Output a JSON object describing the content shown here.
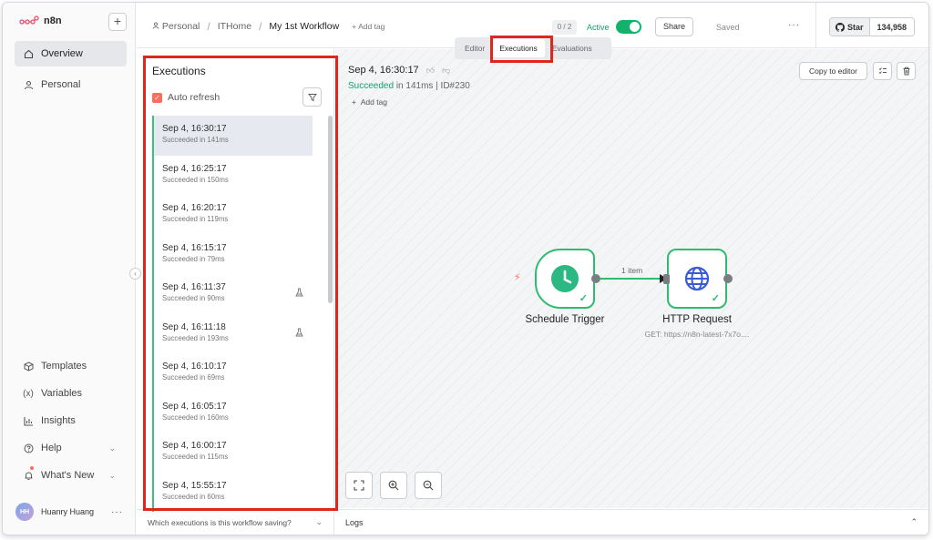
{
  "app": {
    "logo_text": "n8n"
  },
  "sidebar": {
    "plus": "+",
    "top_items": [
      {
        "label": "Overview",
        "icon": "home-icon"
      },
      {
        "label": "Personal",
        "icon": "user-icon"
      }
    ],
    "bottom_items": [
      {
        "label": "Templates",
        "icon": "box-icon"
      },
      {
        "label": "Variables",
        "icon": "variables-icon"
      },
      {
        "label": "Insights",
        "icon": "chart-icon"
      },
      {
        "label": "Help",
        "icon": "help-icon"
      },
      {
        "label": "What's New",
        "icon": "bell-icon"
      }
    ],
    "user": {
      "initials": "HH",
      "name": "Huanry Huang",
      "more": "···"
    }
  },
  "header": {
    "breadcrumb": {
      "project": "Personal",
      "folder": "ITHome",
      "workflow": "My 1st Workflow",
      "add_tag": "+ Add tag"
    },
    "counter": "0 / 2",
    "active_label": "Active",
    "share_label": "Share",
    "saved_label": "Saved",
    "more": "···",
    "github": {
      "star_label": "Star",
      "count": "134,958"
    }
  },
  "tabs": [
    {
      "label": "Editor"
    },
    {
      "label": "Executions"
    },
    {
      "label": "Evaluations"
    }
  ],
  "executions": {
    "title": "Executions",
    "auto_refresh_label": "Auto refresh",
    "items": [
      {
        "time": "Sep 4, 16:30:17",
        "status": "Succeeded in 141ms",
        "selected": true,
        "flask": false
      },
      {
        "time": "Sep 4, 16:25:17",
        "status": "Succeeded in 150ms",
        "selected": false,
        "flask": false
      },
      {
        "time": "Sep 4, 16:20:17",
        "status": "Succeeded in 119ms",
        "selected": false,
        "flask": false
      },
      {
        "time": "Sep 4, 16:15:17",
        "status": "Succeeded in 79ms",
        "selected": false,
        "flask": false
      },
      {
        "time": "Sep 4, 16:11:37",
        "status": "Succeeded in 90ms",
        "selected": false,
        "flask": true
      },
      {
        "time": "Sep 4, 16:11:18",
        "status": "Succeeded in 193ms",
        "selected": false,
        "flask": true
      },
      {
        "time": "Sep 4, 16:10:17",
        "status": "Succeeded in 69ms",
        "selected": false,
        "flask": false
      },
      {
        "time": "Sep 4, 16:05:17",
        "status": "Succeeded in 160ms",
        "selected": false,
        "flask": false
      },
      {
        "time": "Sep 4, 16:00:17",
        "status": "Succeeded in 115ms",
        "selected": false,
        "flask": false
      },
      {
        "time": "Sep 4, 15:55:17",
        "status": "Succeeded in 60ms",
        "selected": false,
        "flask": false
      }
    ],
    "footer_label": "Which executions is this workflow saving?"
  },
  "run": {
    "title": "Sep 4, 16:30:17",
    "status_word": "Succeeded",
    "status_rest": " in 141ms | ID#230",
    "add_tag": "Add tag",
    "copy_label": "Copy to editor"
  },
  "nodes": {
    "trigger": {
      "label": "Schedule Trigger"
    },
    "http": {
      "label": "HTTP Request",
      "subtitle": "GET: https://n8n-latest-7x7o...."
    },
    "connection_label": "1 item"
  },
  "logs": {
    "label": "Logs"
  },
  "colors": {
    "accent": "#ff6d5a",
    "success": "#2ebc6e",
    "highlight": "#e0261b"
  }
}
